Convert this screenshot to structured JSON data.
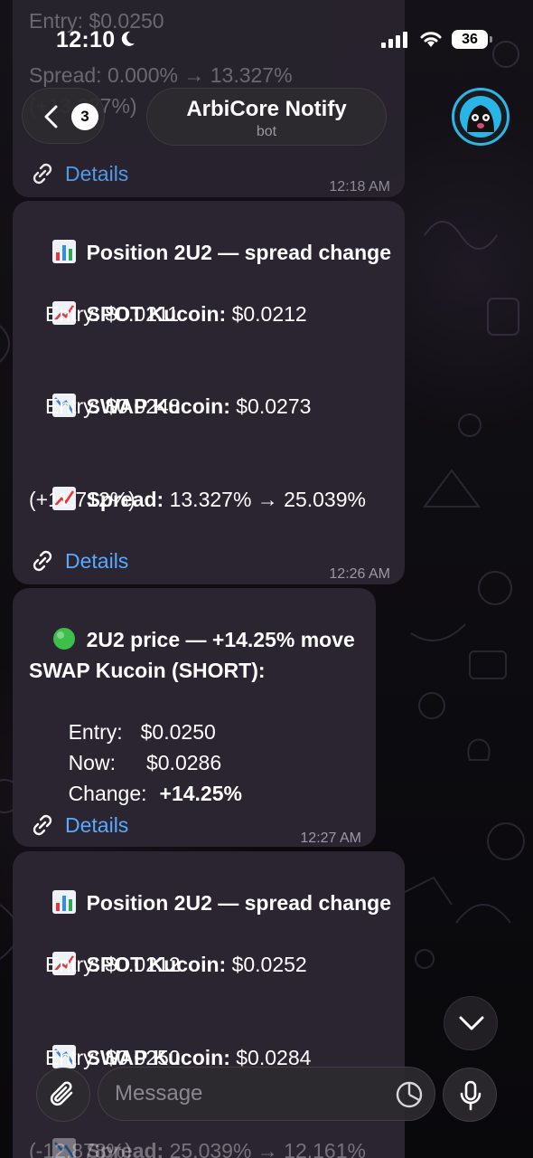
{
  "status_bar": {
    "time": "12:10",
    "battery": "36"
  },
  "header": {
    "back_count": "3",
    "title": "ArbiCore Notify",
    "subtitle": "bot"
  },
  "messages": [
    {
      "id": "prev",
      "lines": [
        "Entry: $0.0250",
        "Spread: 0.000% → 13.327%",
        "(+13.327%)"
      ],
      "link": "Details",
      "time": "12:18 AM"
    },
    {
      "id": "m1",
      "header_icon": "bar-chart-icon",
      "header": "Position 2U2 — spread change",
      "spot_label": "SPOT Kucoin:",
      "spot_value": " $0.0212",
      "spot_entry": "Entry: $0.0211",
      "swap_label": "SWAP Kucoin:",
      "swap_value": " $0.0273",
      "swap_entry": "Entry: $0.0248",
      "spread_label": "Spread:",
      "spread_value": " 13.327% → 25.039%",
      "spread_delta": "(+11.712%)",
      "link": "Details",
      "time": "12:26 AM"
    },
    {
      "id": "m2",
      "header_icon": "green-circle-icon",
      "header": "2U2 price — +14.25% move",
      "swap_title": "SWAP Kucoin (SHORT):",
      "entry_label": "Entry:",
      "entry_value": "$0.0250",
      "now_label": "Now:",
      "now_value": "$0.0286",
      "change_label": "Change:",
      "change_value": "+14.25%",
      "link": "Details",
      "time": "12:27 AM"
    },
    {
      "id": "m3",
      "header_icon": "bar-chart-icon",
      "header": "Position 2U2 — spread change",
      "spot_label": "SPOT Kucoin:",
      "spot_value": " $0.0252",
      "spot_entry": "Entry: $0.0212",
      "swap_label": "SWAP Kucoin:",
      "swap_value": " $0.0284",
      "swap_entry": "Entry: $0.0250",
      "spread_label": "Spread:",
      "spread_value": " 25.039% → 12.161%",
      "spread_delta": "(-12.878%)"
    }
  ],
  "composer": {
    "placeholder": "Message"
  },
  "colors": {
    "link": "#5aa8ff",
    "bubble": "#2a2530",
    "avatar_ring": "#2ab7e8"
  }
}
